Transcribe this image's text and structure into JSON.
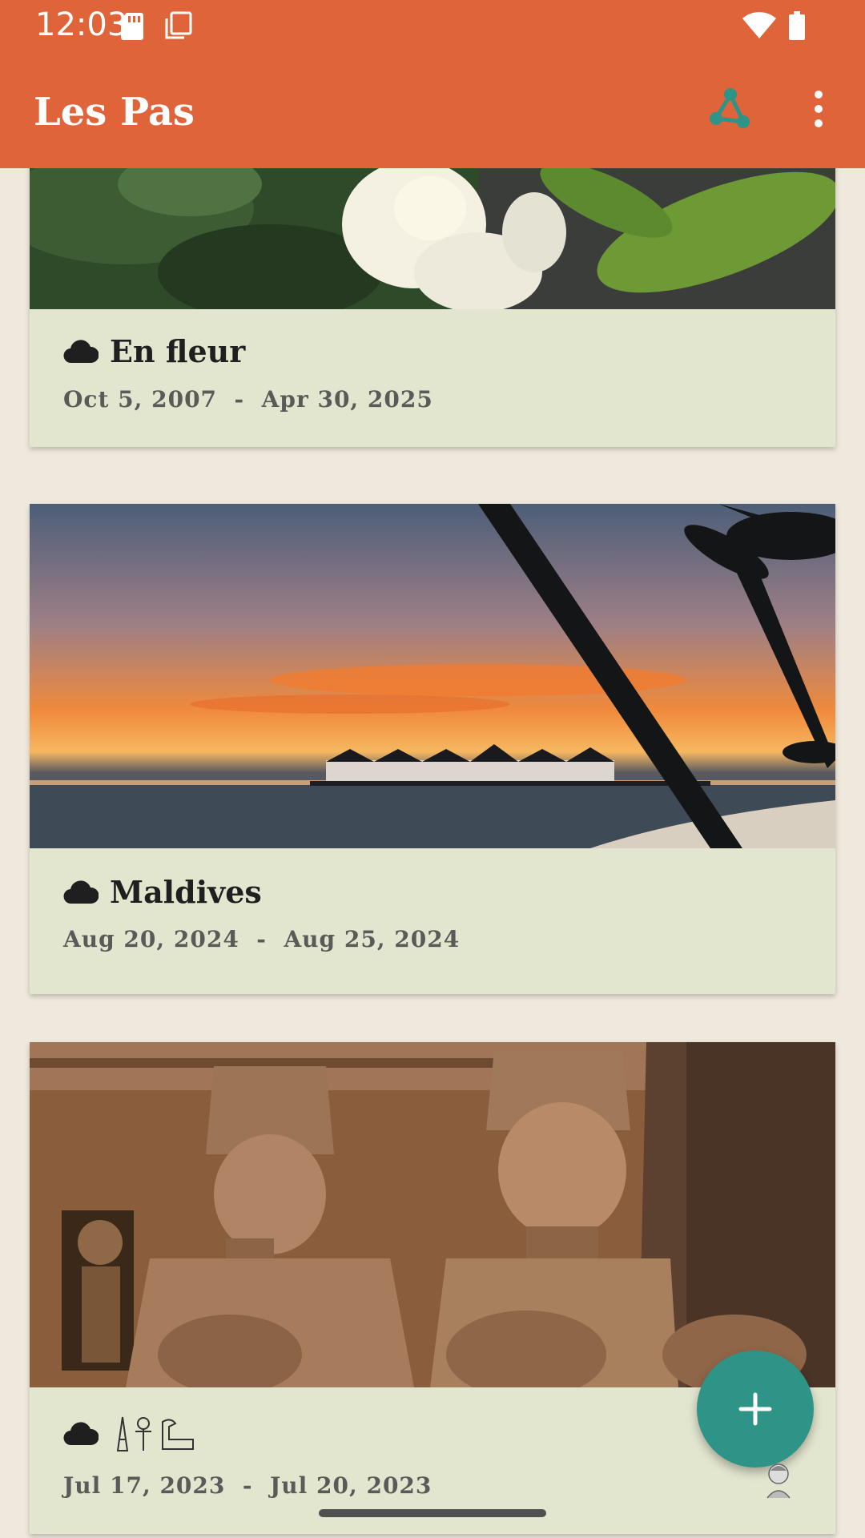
{
  "status_bar": {
    "time": "12:03"
  },
  "app_bar": {
    "title": "Les Pas"
  },
  "albums": [
    {
      "title": "En fleur",
      "date_start": "Oct 5, 2007",
      "date_end": "Apr 30, 2025",
      "remote_icon": "cloud-icon"
    },
    {
      "title": "Maldives",
      "date_start": "Aug 20, 2024",
      "date_end": "Aug 25, 2024",
      "remote_icon": "cloud-icon"
    },
    {
      "title": "",
      "date_start": "Jul 17, 2023",
      "date_end": "Jul 20, 2023",
      "remote_icon": "cloud-icon",
      "title_glyphs": [
        "obelisk-glyph",
        "ankh-glyph",
        "hieroglyph-glyph"
      ]
    }
  ],
  "date_separator": "  -  ",
  "fab": {
    "icon": "plus-icon"
  },
  "colors": {
    "app_bar": "#df643a",
    "card": "#e3e6cf",
    "background": "#efe8dc",
    "fab": "#2e9488",
    "share_icon": "#2e9488"
  }
}
